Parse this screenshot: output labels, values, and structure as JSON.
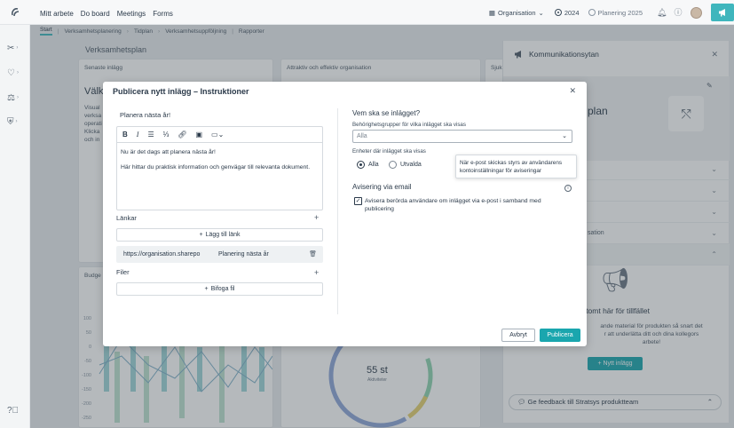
{
  "topnav": {
    "items": [
      "Mitt arbete",
      "Do board",
      "Meetings",
      "Forms"
    ]
  },
  "topright": {
    "org_label": "Organisation",
    "year": "2024",
    "plan": "Planering 2025"
  },
  "subnav": {
    "items": [
      "Start",
      "Verksamhetsplanering",
      "Tidplan",
      "Verksamhetsuppföljning",
      "Rapporter"
    ]
  },
  "background": {
    "page_title": "Verksamhetsplan",
    "card1_title": "Senaste inlägg",
    "card1_heading": "Välk",
    "card1_lines": [
      "Visual",
      "verksa",
      "operati",
      "Klicka",
      "och in"
    ],
    "card2_title": "Attraktiv och effektiv organisation",
    "card3_title": "Sjuk",
    "budget_title": "Budge",
    "donut_value": "55 st",
    "donut_label": "Aktiviteter",
    "chart_ticks": [
      "100",
      "50",
      "0",
      "-50",
      "-100",
      "-150",
      "-200",
      "-250"
    ]
  },
  "rpanel": {
    "title": "Kommunikationsytan",
    "heading_fragment": "plan",
    "row_label": "sation",
    "empty_title": "r tomt här för tillfället",
    "empty_lines": [
      "ande material för produkten så snart det",
      "r att underlätta ditt och dina kollegors",
      "arbete!"
    ],
    "new_post": "Nytt inlägg",
    "feedback": "Ge feedback till Stratsys produktteam"
  },
  "modal": {
    "title": "Publicera nytt inlägg – Instruktioner",
    "post_title": "Planera nästa år!",
    "body_p1": "Nu är det dags att planera nästa år!",
    "body_p2": "Här hittar du praktisk information och genvägar till relevanta dokument.",
    "links_label": "Länkar",
    "add_link": "Lägg till länk",
    "link_url": "https://organisation.sharepo",
    "link_name": "Planering nästa år",
    "files_label": "Filer",
    "attach_file": "Bifoga fil",
    "who_heading": "Vem ska se inlägget?",
    "groups_label": "Behörighetsgrupper för vilka inlägget ska visas",
    "groups_value": "Alla",
    "units_label": "Enheter där inlägget ska visas",
    "radio_all": "Alla",
    "radio_select": "Utvalda",
    "tooltip": "När e-post skickas styrs av användarens kontoinställningar för aviseringar",
    "email_heading": "Avisering via email",
    "email_checkbox": "Avisera berörda användare om inlägget via e-post i samband med publicering",
    "cancel": "Avbryt",
    "publish": "Publicera"
  },
  "colors": {
    "accent": "#1aa6ae",
    "announce": "#3fb6bd"
  }
}
